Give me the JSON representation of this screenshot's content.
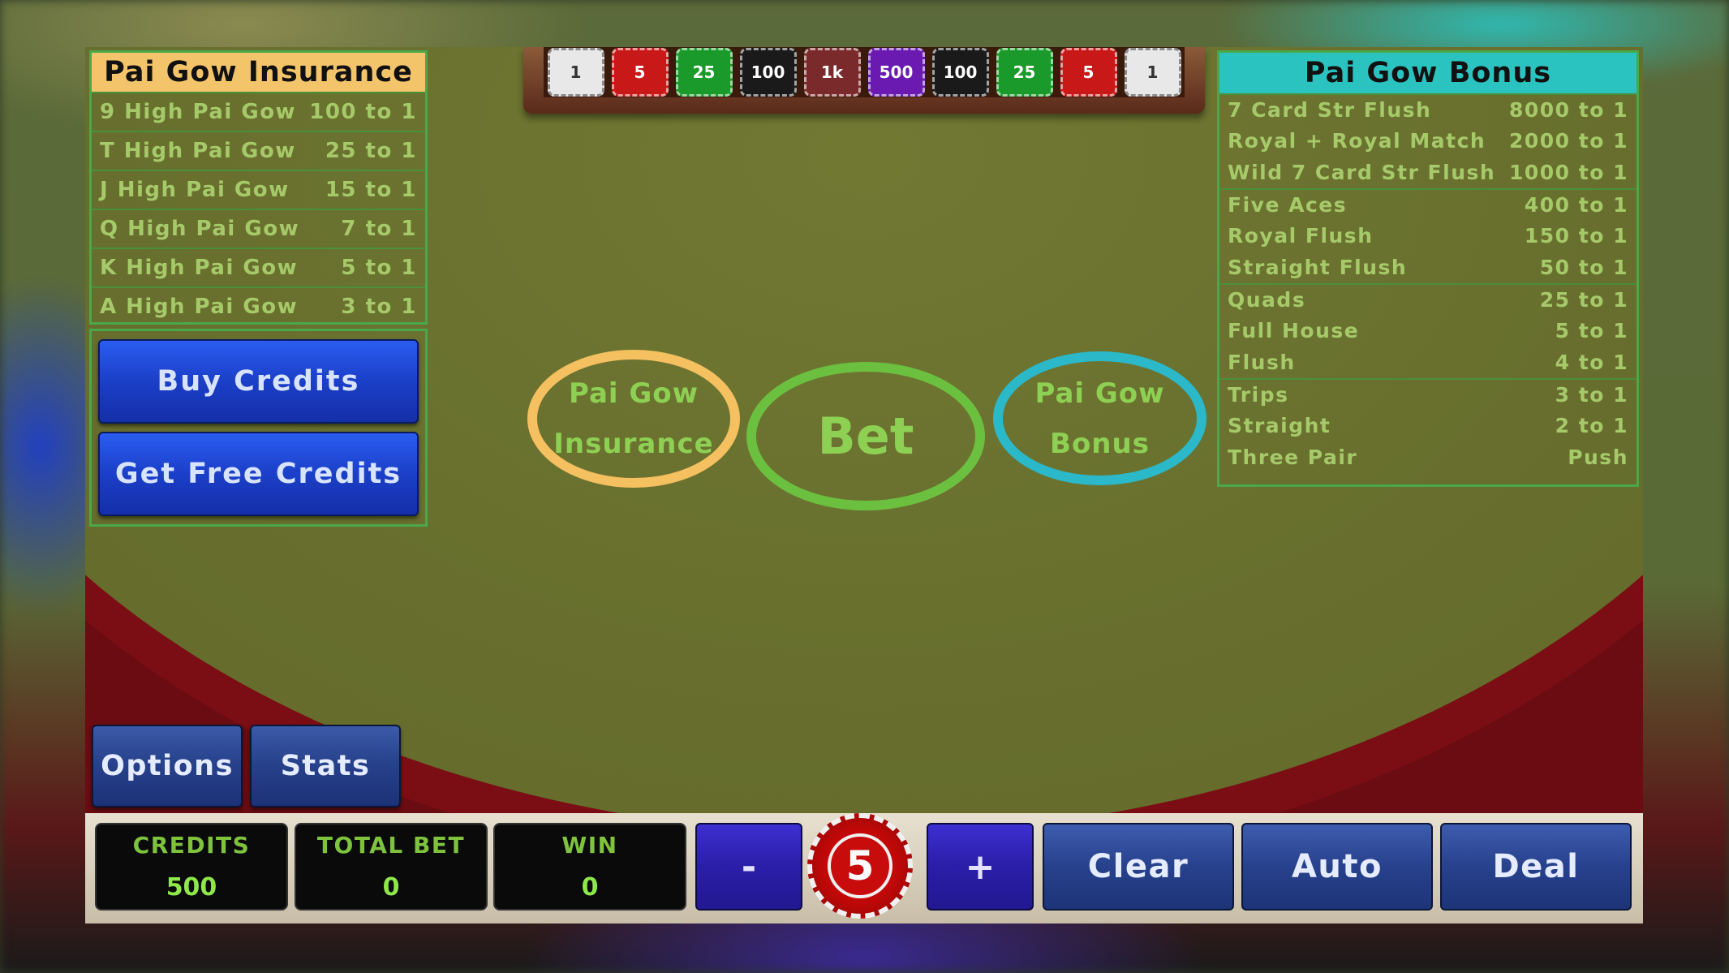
{
  "rack_chips": [
    {
      "label": "1",
      "color": "#e8e8e8"
    },
    {
      "label": "5",
      "color": "#c81818"
    },
    {
      "label": "25",
      "color": "#1a9a2a"
    },
    {
      "label": "100",
      "color": "#1a1a1a"
    },
    {
      "label": "1k",
      "color": "#7a2a2a"
    },
    {
      "label": "500",
      "color": "#6a1ab0"
    },
    {
      "label": "100",
      "color": "#1a1a1a"
    },
    {
      "label": "25",
      "color": "#1a9a2a"
    },
    {
      "label": "5",
      "color": "#c81818"
    },
    {
      "label": "1",
      "color": "#e8e8e8"
    }
  ],
  "insurance": {
    "title": "Pai Gow Insurance",
    "rows": [
      {
        "hand": "9 High Pai Gow",
        "pay": "100 to 1"
      },
      {
        "hand": "T High Pai Gow",
        "pay": "25 to 1"
      },
      {
        "hand": "J High Pai Gow",
        "pay": "15 to 1"
      },
      {
        "hand": "Q High Pai Gow",
        "pay": "7 to 1"
      },
      {
        "hand": "K High Pai Gow",
        "pay": "5 to 1"
      },
      {
        "hand": "A High Pai Gow",
        "pay": "3 to 1"
      }
    ]
  },
  "bonus": {
    "title": "Pai Gow Bonus",
    "rows": [
      {
        "hand": "7 Card Str Flush",
        "pay": "8000 to 1"
      },
      {
        "hand": "Royal + Royal Match",
        "pay": "2000 to 1"
      },
      {
        "hand": "Wild 7 Card Str Flush",
        "pay": "1000 to 1"
      },
      {
        "hand": "Five Aces",
        "pay": "400 to 1"
      },
      {
        "hand": "Royal Flush",
        "pay": "150 to 1"
      },
      {
        "hand": "Straight Flush",
        "pay": "50 to 1"
      },
      {
        "hand": "Quads",
        "pay": "25 to 1"
      },
      {
        "hand": "Full House",
        "pay": "5 to 1"
      },
      {
        "hand": "Flush",
        "pay": "4 to 1"
      },
      {
        "hand": "Trips",
        "pay": "3 to 1"
      },
      {
        "hand": "Straight",
        "pay": "2 to 1"
      },
      {
        "hand": "Three Pair",
        "pay": "Push"
      }
    ]
  },
  "buttons": {
    "buy_credits": "Buy Credits",
    "get_free_credits": "Get Free Credits",
    "options": "Options",
    "stats": "Stats",
    "minus": "-",
    "plus": "+",
    "clear": "Clear",
    "auto": "Auto",
    "deal": "Deal"
  },
  "bet_spots": {
    "insurance_line1": "Pai Gow",
    "insurance_line2": "Insurance",
    "bet": "Bet",
    "bonus_line1": "Pai Gow",
    "bonus_line2": "Bonus"
  },
  "meters": {
    "credits_label": "CREDITS",
    "credits_value": "500",
    "total_bet_label": "TOTAL BET",
    "total_bet_value": "0",
    "win_label": "WIN",
    "win_value": "0"
  },
  "chip_denomination": "5",
  "colors": {
    "insurance_accent": "#f4c460",
    "bonus_accent": "#2bc3c0",
    "bet_accent": "#6cc040",
    "paytable_text": "#a6c96a"
  }
}
